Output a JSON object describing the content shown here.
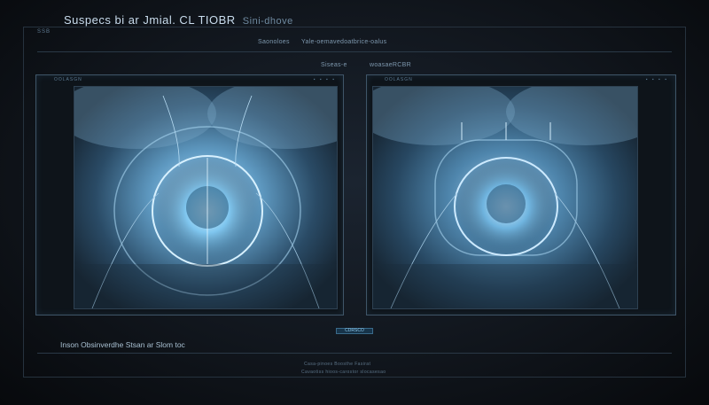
{
  "header": {
    "title": "Suspecs bi ar Jmial. CL TIOBR",
    "subtitle": "Sini-dhove",
    "frame_tag": "SSB"
  },
  "row1": {
    "left": "Saonoloes",
    "right": "Yale-oemavedoatbrice-oalus"
  },
  "row2": {
    "left": "Siseas-e",
    "right": "woasaeRCBR"
  },
  "panels": [
    {
      "tag": "OOLASGN",
      "controls": "▪ ▪ ▪ ▪"
    },
    {
      "tag": "OOLASGN",
      "controls": "▪ ▪ ▪ ▪"
    }
  ],
  "center_button": "CDRSCO",
  "caption": "Inson Obsinverdhe Stsan ar Slom toc",
  "footer": {
    "line1": "Casa-pinoes Boosthe Fasirat",
    "line2": "Cavaotiss hioos-carostor slocasesao"
  },
  "colors": {
    "accent": "#8ec9ee",
    "panel_border": "#3f5568",
    "background": "#11161d"
  },
  "icons": {
    "viewer_image": "ct-scan-image"
  }
}
